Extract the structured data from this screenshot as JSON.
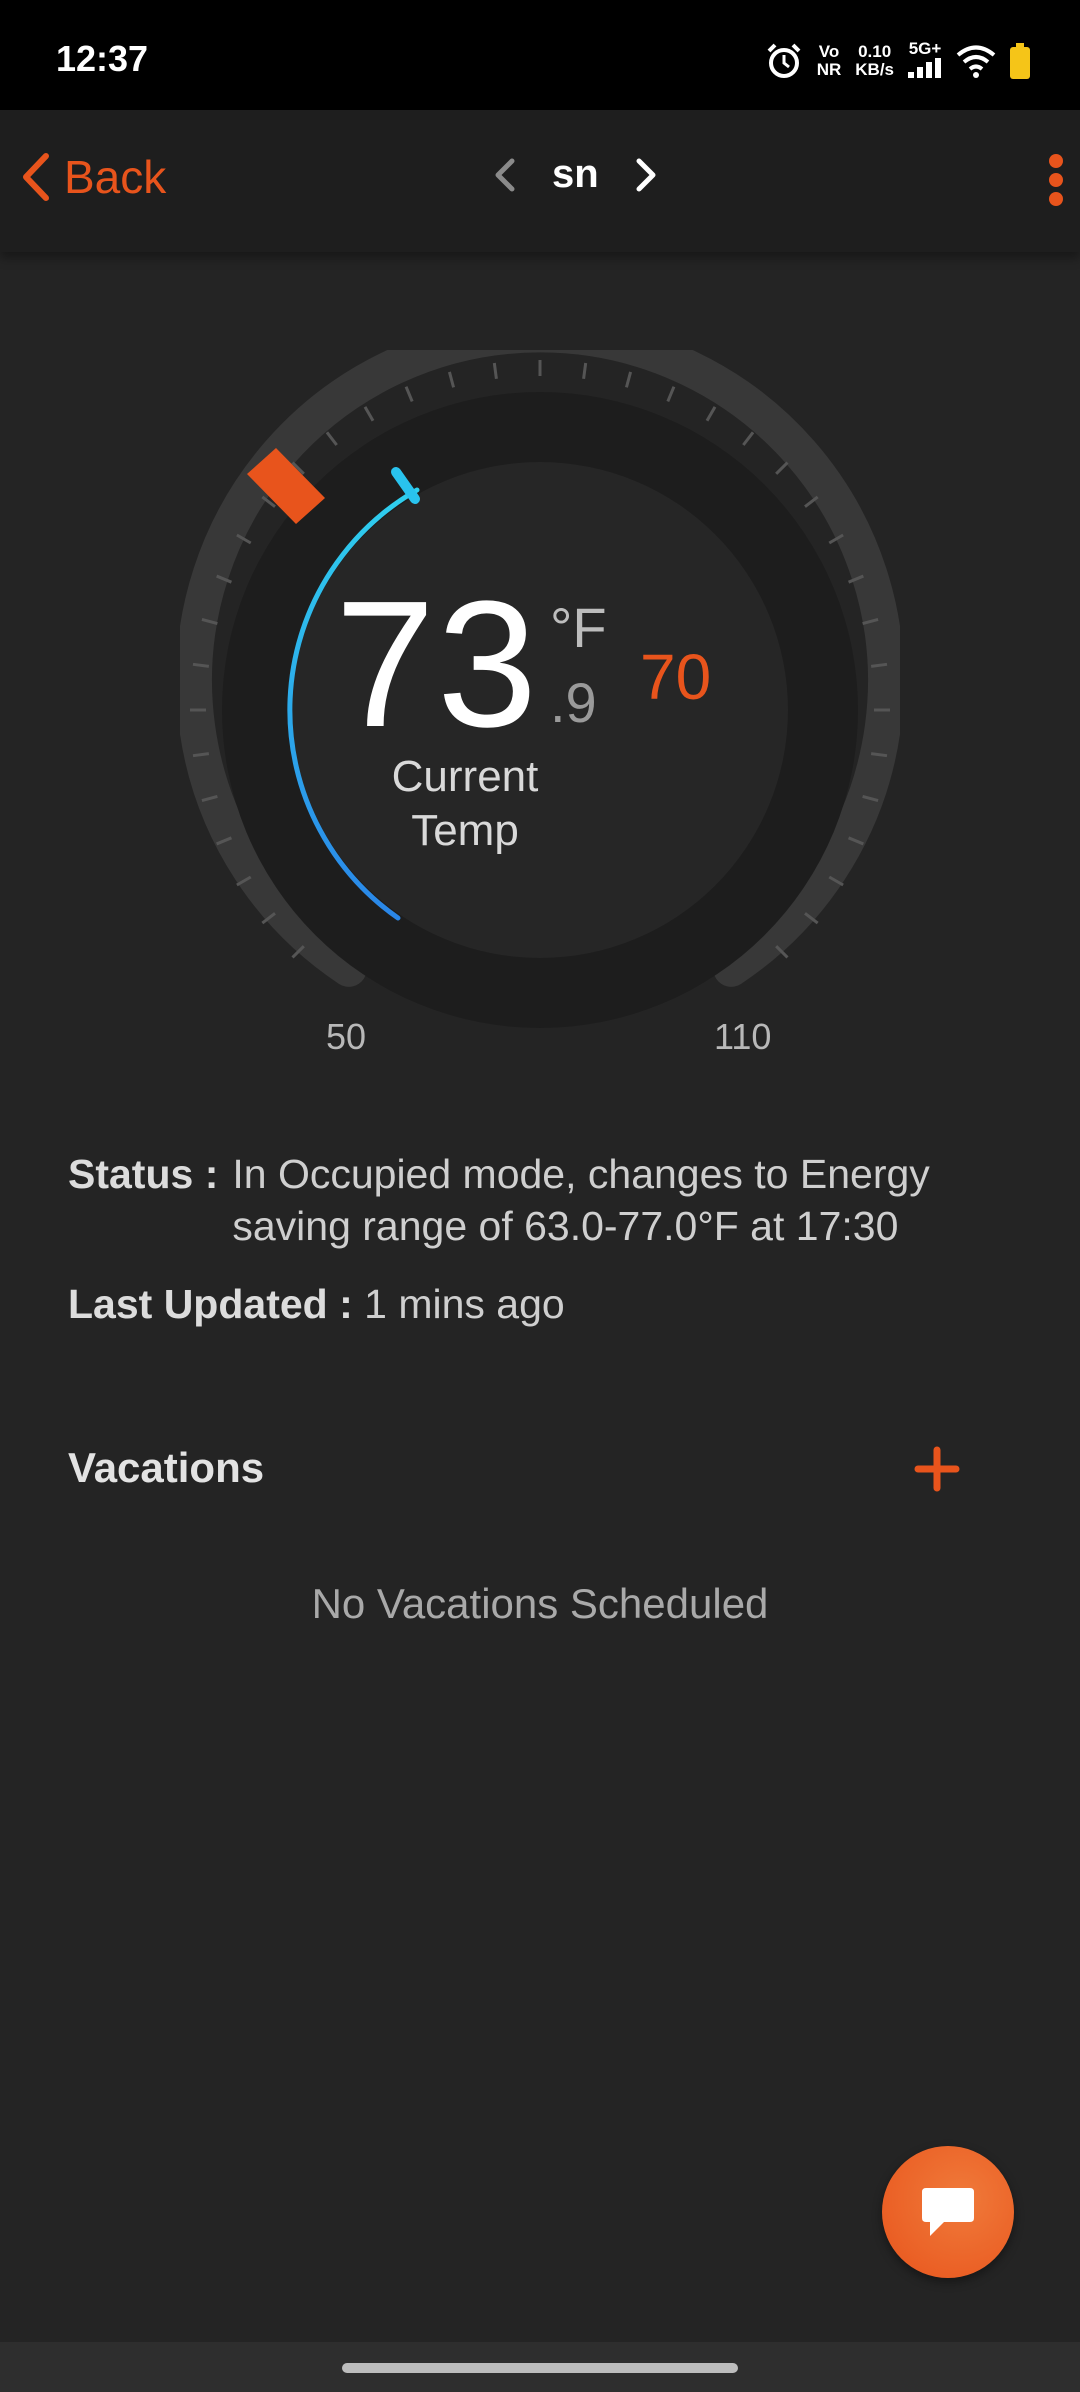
{
  "status_bar": {
    "time": "12:37",
    "network_top": "Vo",
    "network_bottom": "NR",
    "speed_value": "0.10",
    "speed_unit": "KB/s",
    "signal_label": "5G+"
  },
  "header": {
    "back_label": "Back",
    "device_name": "sn"
  },
  "thermostat": {
    "current_temp_whole": "73",
    "current_temp_decimal": ".9",
    "unit": "°F",
    "setpoint": "70",
    "current_label": "Current Temp",
    "range_min": "50",
    "range_max": "110",
    "accent_color": "#e8541c",
    "arc_color": "#29c3ee"
  },
  "info": {
    "status_label": "Status :",
    "status_value": "In Occupied mode, changes to Energy saving range of 63.0-77.0°F at 17:30",
    "updated_label": "Last Updated :",
    "updated_value": "1 mins ago"
  },
  "vacations": {
    "title": "Vacations",
    "empty_text": "No Vacations Scheduled",
    "add_icon": "plus-icon"
  },
  "fab": {
    "icon": "chat-icon"
  }
}
